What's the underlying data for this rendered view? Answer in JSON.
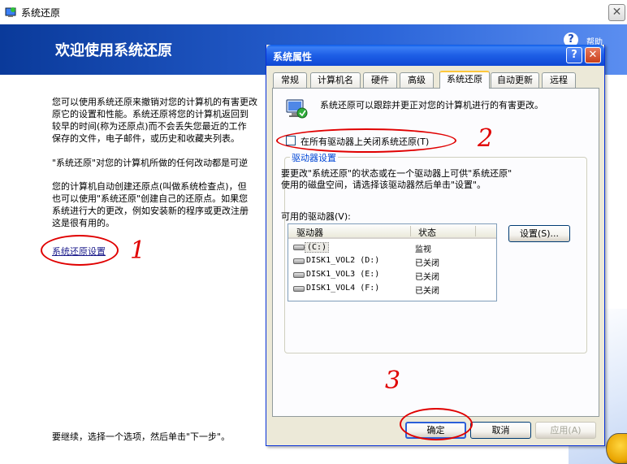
{
  "background_window": {
    "title": "系统还原",
    "close_glyph": "✕",
    "heading": "欢迎使用系统还原",
    "help_glyph": "?",
    "help_label": "帮助",
    "paragraphs": [
      "您可以使用系统还原来撤销对您的计算机的有害更改\n原它的设置和性能。系统还原将您的计算机返回到\n较早的时间(称为还原点)而不会丢失您最近的工作\n保存的文件，电子邮件，或历史和收藏夹列表。",
      "\"系统还原\"对您的计算机所做的任何改动都是可逆",
      "您的计算机自动创建还原点(叫做系统检查点)，但\n也可以使用\"系统还原\"创建自己的还原点。如果您\n系统进行大的更改，例如安装新的程序或更改注册\n这是很有用的。"
    ],
    "settings_link": "系统还原设置",
    "footer": "要继续，选择一个选项，然后单击\"下一步\"。"
  },
  "annotations": [
    "1",
    "2",
    "3"
  ],
  "dialog": {
    "title": "系统属性",
    "help_glyph": "?",
    "close_glyph": "✕",
    "tabs": [
      {
        "label": "常规"
      },
      {
        "label": "计算机名"
      },
      {
        "label": "硬件"
      },
      {
        "label": "高级"
      },
      {
        "label": "系统还原",
        "active": true
      },
      {
        "label": "自动更新"
      },
      {
        "label": "远程"
      }
    ],
    "description": "系统还原可以跟踪并更正对您的计算机进行的有害更改。",
    "disable_checkbox": {
      "label": "在所有驱动器上关闭系统还原(T)",
      "checked": false
    },
    "drive_settings": {
      "title": "驱动器设置",
      "description": "要更改\"系统还原\"的状态或在一个驱动器上可供\"系统还原\"\n使用的磁盘空间，请选择该驱动器然后单击\"设置\"。",
      "available_label": "可用的驱动器(V):",
      "columns": [
        "驱动器",
        "状态"
      ],
      "drives": [
        {
          "name": "(C:)",
          "status": "监视"
        },
        {
          "name": "DISK1_VOL2 (D:)",
          "status": "已关闭"
        },
        {
          "name": "DISK1_VOL3 (E:)",
          "status": "已关闭"
        },
        {
          "name": "DISK1_VOL4 (F:)",
          "status": "已关闭"
        }
      ],
      "settings_button": "设置(S)..."
    },
    "buttons": {
      "ok": "确定",
      "cancel": "取消",
      "apply": "应用(A)"
    }
  }
}
